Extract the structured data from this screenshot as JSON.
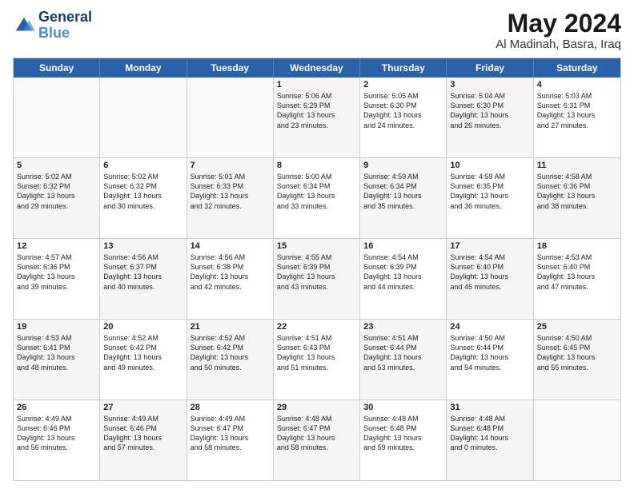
{
  "header": {
    "logo_line1": "General",
    "logo_line2": "Blue",
    "month_title": "May 2024",
    "location": "Al Madinah, Basra, Iraq"
  },
  "day_headers": [
    "Sunday",
    "Monday",
    "Tuesday",
    "Wednesday",
    "Thursday",
    "Friday",
    "Saturday"
  ],
  "weeks": [
    [
      {
        "num": "",
        "info": ""
      },
      {
        "num": "",
        "info": ""
      },
      {
        "num": "",
        "info": ""
      },
      {
        "num": "1",
        "info": "Sunrise: 5:06 AM\nSunset: 6:29 PM\nDaylight: 13 hours\nand 23 minutes."
      },
      {
        "num": "2",
        "info": "Sunrise: 5:05 AM\nSunset: 6:30 PM\nDaylight: 13 hours\nand 24 minutes."
      },
      {
        "num": "3",
        "info": "Sunrise: 5:04 AM\nSunset: 6:30 PM\nDaylight: 13 hours\nand 26 minutes."
      },
      {
        "num": "4",
        "info": "Sunrise: 5:03 AM\nSunset: 6:31 PM\nDaylight: 13 hours\nand 27 minutes."
      }
    ],
    [
      {
        "num": "5",
        "info": "Sunrise: 5:02 AM\nSunset: 6:32 PM\nDaylight: 13 hours\nand 29 minutes."
      },
      {
        "num": "6",
        "info": "Sunrise: 5:02 AM\nSunset: 6:32 PM\nDaylight: 13 hours\nand 30 minutes."
      },
      {
        "num": "7",
        "info": "Sunrise: 5:01 AM\nSunset: 6:33 PM\nDaylight: 13 hours\nand 32 minutes."
      },
      {
        "num": "8",
        "info": "Sunrise: 5:00 AM\nSunset: 6:34 PM\nDaylight: 13 hours\nand 33 minutes."
      },
      {
        "num": "9",
        "info": "Sunrise: 4:59 AM\nSunset: 6:34 PM\nDaylight: 13 hours\nand 35 minutes."
      },
      {
        "num": "10",
        "info": "Sunrise: 4:59 AM\nSunset: 6:35 PM\nDaylight: 13 hours\nand 36 minutes."
      },
      {
        "num": "11",
        "info": "Sunrise: 4:58 AM\nSunset: 6:36 PM\nDaylight: 13 hours\nand 38 minutes."
      }
    ],
    [
      {
        "num": "12",
        "info": "Sunrise: 4:57 AM\nSunset: 6:36 PM\nDaylight: 13 hours\nand 39 minutes."
      },
      {
        "num": "13",
        "info": "Sunrise: 4:56 AM\nSunset: 6:37 PM\nDaylight: 13 hours\nand 40 minutes."
      },
      {
        "num": "14",
        "info": "Sunrise: 4:56 AM\nSunset: 6:38 PM\nDaylight: 13 hours\nand 42 minutes."
      },
      {
        "num": "15",
        "info": "Sunrise: 4:55 AM\nSunset: 6:39 PM\nDaylight: 13 hours\nand 43 minutes."
      },
      {
        "num": "16",
        "info": "Sunrise: 4:54 AM\nSunset: 6:39 PM\nDaylight: 13 hours\nand 44 minutes."
      },
      {
        "num": "17",
        "info": "Sunrise: 4:54 AM\nSunset: 6:40 PM\nDaylight: 13 hours\nand 45 minutes."
      },
      {
        "num": "18",
        "info": "Sunrise: 4:53 AM\nSunset: 6:40 PM\nDaylight: 13 hours\nand 47 minutes."
      }
    ],
    [
      {
        "num": "19",
        "info": "Sunrise: 4:53 AM\nSunset: 6:41 PM\nDaylight: 13 hours\nand 48 minutes."
      },
      {
        "num": "20",
        "info": "Sunrise: 4:52 AM\nSunset: 6:42 PM\nDaylight: 13 hours\nand 49 minutes."
      },
      {
        "num": "21",
        "info": "Sunrise: 4:52 AM\nSunset: 6:42 PM\nDaylight: 13 hours\nand 50 minutes."
      },
      {
        "num": "22",
        "info": "Sunrise: 4:51 AM\nSunset: 6:43 PM\nDaylight: 13 hours\nand 51 minutes."
      },
      {
        "num": "23",
        "info": "Sunrise: 4:51 AM\nSunset: 6:44 PM\nDaylight: 13 hours\nand 53 minutes."
      },
      {
        "num": "24",
        "info": "Sunrise: 4:50 AM\nSunset: 6:44 PM\nDaylight: 13 hours\nand 54 minutes."
      },
      {
        "num": "25",
        "info": "Sunrise: 4:50 AM\nSunset: 6:45 PM\nDaylight: 13 hours\nand 55 minutes."
      }
    ],
    [
      {
        "num": "26",
        "info": "Sunrise: 4:49 AM\nSunset: 6:46 PM\nDaylight: 13 hours\nand 56 minutes."
      },
      {
        "num": "27",
        "info": "Sunrise: 4:49 AM\nSunset: 6:46 PM\nDaylight: 13 hours\nand 57 minutes."
      },
      {
        "num": "28",
        "info": "Sunrise: 4:49 AM\nSunset: 6:47 PM\nDaylight: 13 hours\nand 58 minutes."
      },
      {
        "num": "29",
        "info": "Sunrise: 4:48 AM\nSunset: 6:47 PM\nDaylight: 13 hours\nand 58 minutes."
      },
      {
        "num": "30",
        "info": "Sunrise: 4:48 AM\nSunset: 6:48 PM\nDaylight: 13 hours\nand 59 minutes."
      },
      {
        "num": "31",
        "info": "Sunrise: 4:48 AM\nSunset: 6:48 PM\nDaylight: 14 hours\nand 0 minutes."
      },
      {
        "num": "",
        "info": ""
      }
    ]
  ]
}
